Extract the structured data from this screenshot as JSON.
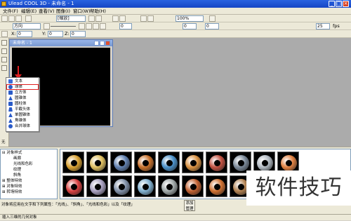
{
  "window": {
    "title": "Ulead COOL 3D - 未命名 - 1",
    "min": "_",
    "max": "□",
    "close": "×"
  },
  "menu": [
    "文件(F)",
    "编辑(E)",
    "查看(V)",
    "图像(I)",
    "窗口(W)",
    "帮助(H)"
  ],
  "toolbar1": {
    "font": "[缩放]",
    "zoom": "100%"
  },
  "toolbar2": {
    "direction": "方向",
    "value1": "0",
    "value2": "0",
    "value3": "0",
    "fps": "25",
    "fps_label": "fps"
  },
  "toolbar3": {
    "x_label": "X:",
    "x": "0",
    "y_label": "Y:",
    "y": "0",
    "z_label": "Z:",
    "z": "0"
  },
  "document": {
    "title": "未命名 - 1"
  },
  "popup_menu": {
    "items": [
      {
        "label": "文本",
        "color": "#3a6bd8"
      },
      {
        "label": "球体",
        "color": "#2a5bc8",
        "selected": true
      },
      {
        "label": "立方体",
        "color": "#2a5bc8"
      },
      {
        "label": "圆锥体",
        "color": "#2a5bc8"
      },
      {
        "label": "圆柱体",
        "color": "#2a5bc8"
      },
      {
        "label": "平截头体",
        "color": "#2a5bc8"
      },
      {
        "label": "单圆锥体",
        "color": "#2a5bc8"
      },
      {
        "label": "角锥体",
        "color": "#2a5bc8"
      },
      {
        "label": "合并球体",
        "color": "#2a5bc8"
      }
    ]
  },
  "tree": {
    "items": [
      {
        "label": "对象样式",
        "expander": "⊟"
      },
      {
        "label": "画廊"
      },
      {
        "label": "光线和色彩"
      },
      {
        "label": "纹理"
      },
      {
        "label": "斜角"
      },
      {
        "label": "整体特效",
        "expander": "⊞"
      },
      {
        "label": "对象特效",
        "expander": "⊞"
      },
      {
        "label": "转场特效",
        "expander": "⊞"
      }
    ]
  },
  "thumbnails": {
    "row1": [
      "#d8a030",
      "#e0c060",
      "#6080b0",
      "#c8702a",
      "#4a90c8",
      "#d89040",
      "#c05040",
      "#7a8898",
      "#b0b8c0",
      "#e08040"
    ],
    "row2": [
      "#d84040",
      "#a8a0c0",
      "#8090a8",
      "#80b0d0",
      "#a0a8a8",
      "#c06030",
      "#d07030",
      "#b08050",
      "#909090",
      "#d06040"
    ]
  },
  "info": {
    "text": "对象将应用在文字和下列属性：「光线」、「斜角」、「光线和色彩」以及「纹理」",
    "add_button": "添加",
    "add_button2": "管理"
  },
  "status": {
    "text": "插入三维的几何对象"
  },
  "watermark": {
    "text": "软件技巧"
  },
  "left_hint": "无"
}
